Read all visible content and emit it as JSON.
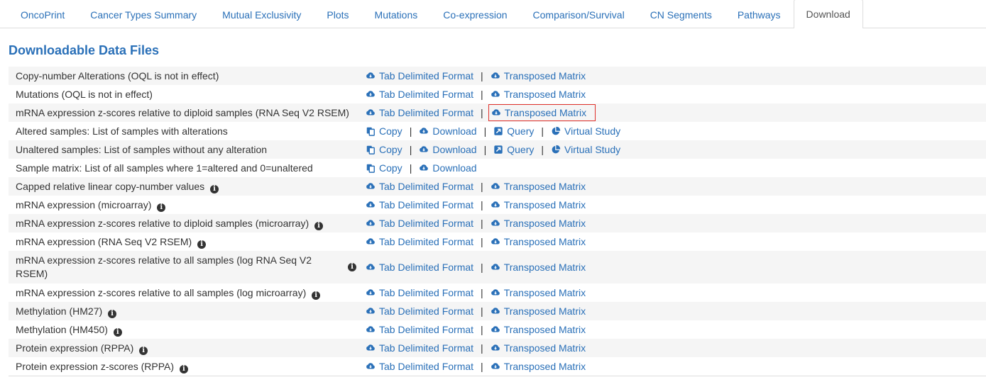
{
  "tabs": [
    {
      "label": "OncoPrint",
      "active": false
    },
    {
      "label": "Cancer Types Summary",
      "active": false
    },
    {
      "label": "Mutual Exclusivity",
      "active": false
    },
    {
      "label": "Plots",
      "active": false
    },
    {
      "label": "Mutations",
      "active": false
    },
    {
      "label": "Co-expression",
      "active": false
    },
    {
      "label": "Comparison/Survival",
      "active": false
    },
    {
      "label": "CN Segments",
      "active": false
    },
    {
      "label": "Pathways",
      "active": false
    },
    {
      "label": "Download",
      "active": true
    }
  ],
  "heading": "Downloadable Data Files",
  "links": {
    "tab_delimited": "Tab Delimited Format",
    "transposed": "Transposed Matrix",
    "copy": "Copy",
    "download": "Download",
    "query": "Query",
    "virtual_study": "Virtual Study",
    "separator": "|"
  },
  "rows": [
    {
      "label": "Copy-number Alterations (OQL is not in effect)",
      "info": false,
      "type": "matrix"
    },
    {
      "label": "Mutations (OQL is not in effect)",
      "info": false,
      "type": "matrix"
    },
    {
      "label": "mRNA expression z-scores relative to diploid samples (RNA Seq V2 RSEM)",
      "info": false,
      "type": "matrix",
      "highlight_transposed": true
    },
    {
      "label": "Altered samples: List of samples with alterations",
      "info": false,
      "type": "samples"
    },
    {
      "label": "Unaltered samples: List of samples without any alteration",
      "info": false,
      "type": "samples"
    },
    {
      "label": "Sample matrix: List of all samples where 1=altered and 0=unaltered",
      "info": false,
      "type": "sample_matrix"
    },
    {
      "label": "Capped relative linear copy-number values",
      "info": true,
      "type": "matrix"
    },
    {
      "label": "mRNA expression (microarray)",
      "info": true,
      "type": "matrix"
    },
    {
      "label": "mRNA expression z-scores relative to diploid samples (microarray)",
      "info": true,
      "type": "matrix"
    },
    {
      "label": "mRNA expression (RNA Seq V2 RSEM)",
      "info": true,
      "type": "matrix"
    },
    {
      "label": "mRNA expression z-scores relative to all samples (log RNA Seq V2 RSEM)",
      "info": true,
      "type": "matrix",
      "tall": true
    },
    {
      "label": "mRNA expression z-scores relative to all samples (log microarray)",
      "info": true,
      "type": "matrix"
    },
    {
      "label": "Methylation (HM27)",
      "info": true,
      "type": "matrix"
    },
    {
      "label": "Methylation (HM450)",
      "info": true,
      "type": "matrix"
    },
    {
      "label": "Protein expression (RPPA)",
      "info": true,
      "type": "matrix"
    },
    {
      "label": "Protein expression z-scores (RPPA)",
      "info": true,
      "type": "matrix"
    }
  ],
  "colors": {
    "link": "#2a70b8",
    "highlight_border": "#e0312b",
    "stripe": "#f5f5f5"
  }
}
